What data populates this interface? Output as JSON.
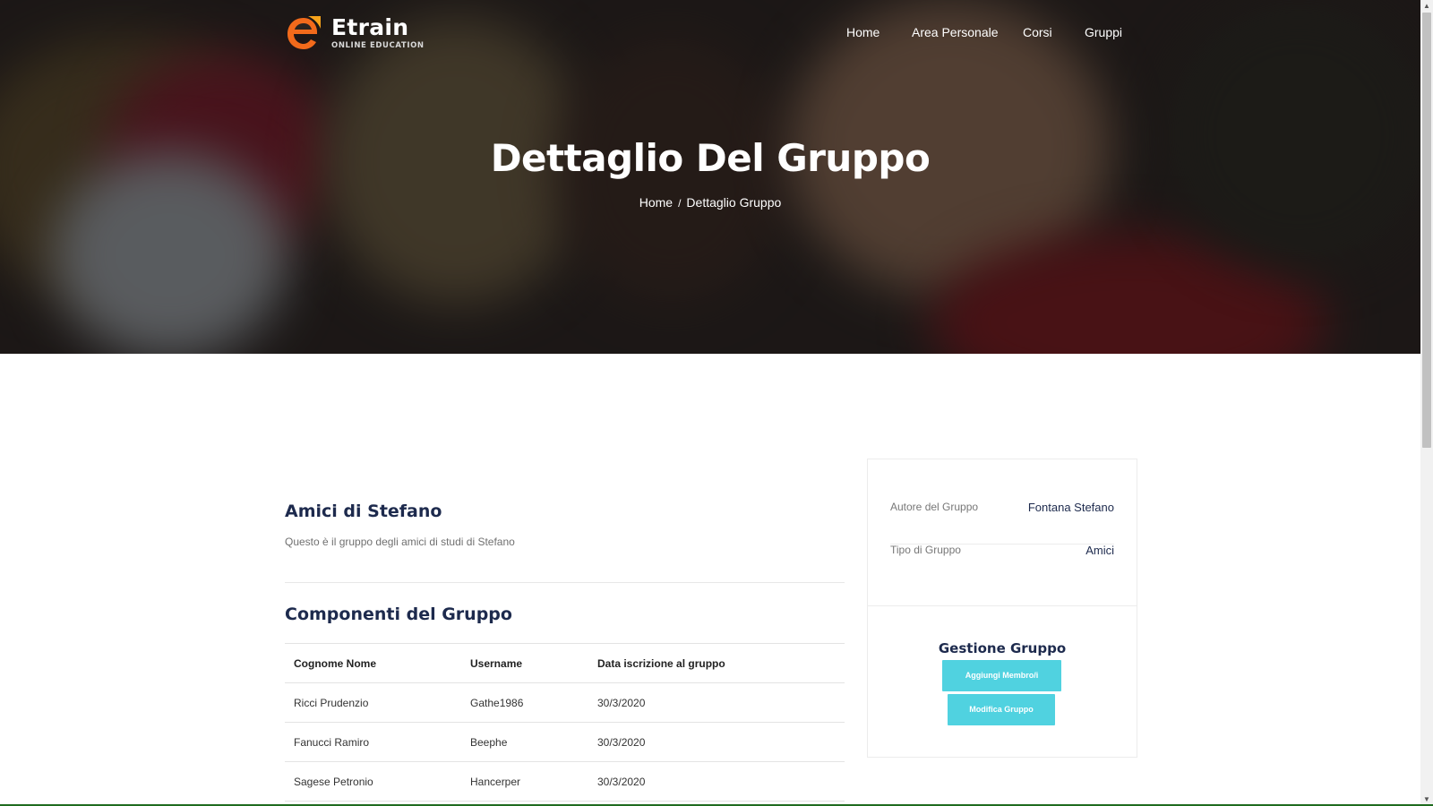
{
  "brand": {
    "name": "Etrain",
    "tagline": "ONLINE EDUCATION",
    "accent": "#f26a1b"
  },
  "nav": {
    "items": [
      "Home",
      "Area Personale",
      "Corsi",
      "Gruppi"
    ]
  },
  "hero": {
    "title": "Dettaglio Del Gruppo",
    "breadcrumb": {
      "home": "Home",
      "separator": "/",
      "current": "Dettaglio Gruppo"
    }
  },
  "group": {
    "title": "Amici di Stefano",
    "description": "Questo è il gruppo degli amici di studi di Stefano"
  },
  "members": {
    "title": "Componenti del Gruppo",
    "columns": [
      "Cognome Nome",
      "Username",
      "Data iscrizione al gruppo"
    ],
    "rows": [
      [
        "Ricci Prudenzio",
        "Gathe1986",
        "30/3/2020"
      ],
      [
        "Fanucci Ramiro",
        "Beephe",
        "30/3/2020"
      ],
      [
        "Sagese Petronio",
        "Hancerper",
        "30/3/2020"
      ]
    ]
  },
  "sidebar": {
    "author_label": "Autore del Gruppo",
    "author_value": "Fontana Stefano",
    "type_label": "Tipo di Gruppo",
    "type_value": "Amici",
    "manage_title": "Gestione Gruppo",
    "add_button": "Aggiungi Membro/i",
    "edit_button": "Modifica Gruppo",
    "button_color": "#50d2e0"
  }
}
